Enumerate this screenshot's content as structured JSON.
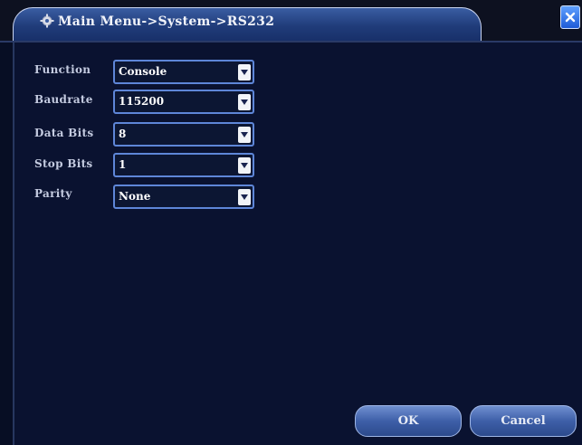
{
  "window": {
    "title": "Main Menu->System->RS232",
    "icon": "settings-icon",
    "close_icon": "close-icon"
  },
  "form": {
    "fields": [
      {
        "label": "Function",
        "value": "Console"
      },
      {
        "label": "Baudrate",
        "value": "115200"
      },
      {
        "label": "Data Bits",
        "value": "8"
      },
      {
        "label": "Stop Bits",
        "value": "1"
      },
      {
        "label": "Parity",
        "value": "None"
      }
    ]
  },
  "buttons": {
    "ok": "OK",
    "cancel": "Cancel"
  },
  "colors": {
    "background": "#0a1230",
    "accent": "#5e86d8",
    "title_tab": "#203c7a"
  }
}
